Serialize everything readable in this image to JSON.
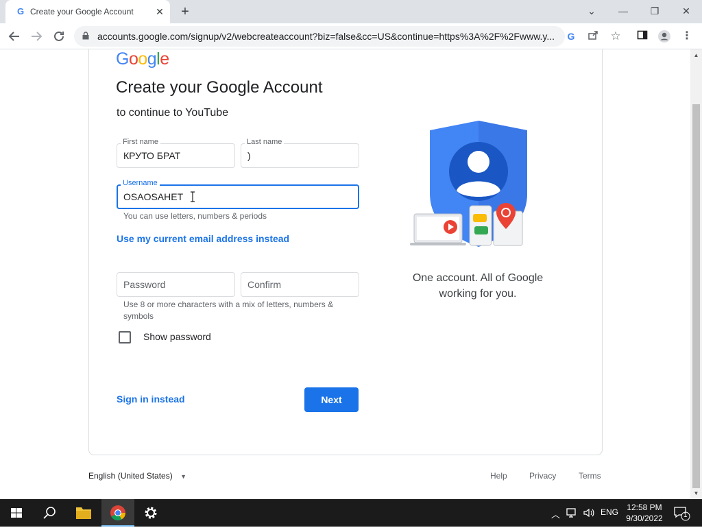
{
  "browser": {
    "tab_title": "Create your Google Account",
    "tab_favicon": "G",
    "tab_close": "✕",
    "new_tab": "+",
    "url": "accounts.google.com/signup/v2/webcreateaccount?biz=false&cc=US&continue=https%3A%2F%2Fwww.y...",
    "window_controls": {
      "dropdown": "⌄",
      "minimize": "—",
      "restore": "❐",
      "close": "✕"
    }
  },
  "page": {
    "logo": [
      "G",
      "o",
      "o",
      "g",
      "l",
      "e"
    ],
    "heading": "Create your Google Account",
    "subheading": "to continue to YouTube",
    "first_name": {
      "label": "First name",
      "value": "КРУТО БРАТ"
    },
    "last_name": {
      "label": "Last name",
      "value": ")"
    },
    "username": {
      "label": "Username",
      "value": "OSAOSAHET",
      "hint": "You can use letters, numbers & periods"
    },
    "use_email_link": "Use my current email address instead",
    "password": {
      "placeholder": "Password"
    },
    "confirm": {
      "placeholder": "Confirm"
    },
    "password_hint": "Use 8 or more characters with a mix of letters, numbers & symbols",
    "show_password": {
      "label": "Show password",
      "checked": false
    },
    "sign_in_link": "Sign in instead",
    "next_button": "Next",
    "tagline": "One account. All of Google working for you."
  },
  "footer": {
    "language": "English (United States)",
    "links": [
      "Help",
      "Privacy",
      "Terms"
    ]
  },
  "taskbar": {
    "language": "ENG",
    "time": "12:58 PM",
    "date": "9/30/2022",
    "notifications": "1"
  },
  "colors": {
    "accent": "#1a73e8",
    "google_blue": "#4285f4",
    "google_red": "#ea4335",
    "google_yellow": "#fbbc05",
    "google_green": "#34a853"
  }
}
